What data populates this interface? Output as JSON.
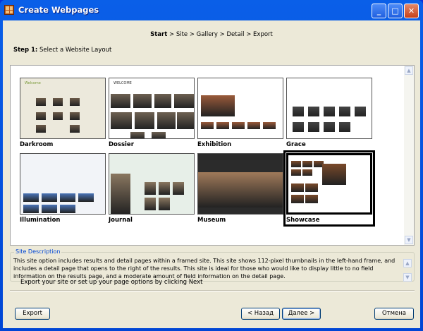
{
  "window": {
    "title": "Create Webpages"
  },
  "breadcrumb": {
    "current": "Start",
    "rest": " > Site > Gallery > Detail > Export"
  },
  "step": {
    "label": "Step 1:",
    "text": " Select a Website Layout"
  },
  "layouts": [
    {
      "name": "Darkroom",
      "heading": "Welcome",
      "selected": false
    },
    {
      "name": "Dossier",
      "heading": "WELCOME",
      "selected": false
    },
    {
      "name": "Exhibition",
      "heading": "",
      "selected": false
    },
    {
      "name": "Grace",
      "heading": "",
      "selected": false
    },
    {
      "name": "Illumination",
      "heading": "",
      "selected": false
    },
    {
      "name": "Journal",
      "heading": "",
      "selected": false
    },
    {
      "name": "Museum",
      "heading": "",
      "selected": false
    },
    {
      "name": "Showcase",
      "heading": "",
      "selected": true
    }
  ],
  "description": {
    "legend": "Site Description",
    "text": "This site option includes results and detail pages within a framed site. This site shows 112-pixel thumbnails in the left-hand frame, and includes a detail page that opens to the right of the results.  This site is ideal for those who would like to display little to no field information on the results page, and a moderate amount of field information on the detail page."
  },
  "hint": "Export your site or set up your page options by clicking Next",
  "buttons": {
    "export": "Export",
    "back": "< Назад",
    "next": "Далее >",
    "cancel": "Отмена"
  }
}
